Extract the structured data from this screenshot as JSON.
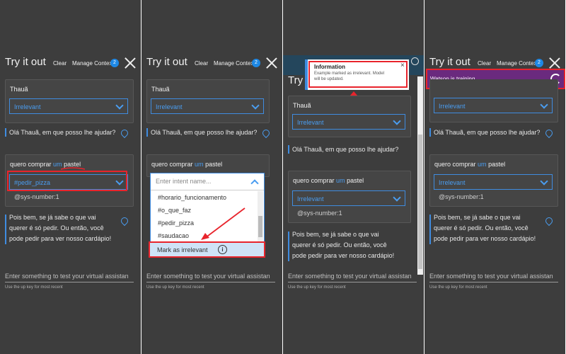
{
  "header": {
    "title": "Try it out",
    "clear": "Clear",
    "manage": "Manage Context",
    "badge": "2",
    "title_short": "Try"
  },
  "card1": {
    "name": "Thauã",
    "value": "Irrelevant"
  },
  "bot1": "Olá Thauã, em que posso lhe ajudar?",
  "user": {
    "before": "quero comprar ",
    "um": "um",
    "space": " ",
    "pastel": "pastel"
  },
  "intent_p1": "#pedir_pizza",
  "intent_irrelevant": "Irrelevant",
  "entity": "@sys-number:1",
  "bot2": {
    "l1": "Pois bem, se já sabe o que vai",
    "l2": "querer é só pedir. Ou então, você",
    "l3": "pode pedir para ver nosso cardápio!"
  },
  "input": {
    "placeholder": "Enter something to test your virtual assistan",
    "hint": "Use the up key for most recent"
  },
  "dropdown": {
    "placeholder": "Enter intent name...",
    "options": [
      "#horario_funcionamento",
      "#o_que_faz",
      "#pedir_pizza",
      "#saudacao"
    ],
    "mark": "Mark as irrelevant",
    "info_glyph": "i"
  },
  "notification": {
    "title": "Information",
    "l1": "Example marked as irrelevant. Model",
    "l2": "will be updated.",
    "close": "×"
  },
  "training": {
    "text": "Watson is training"
  },
  "colors": {
    "accent": "#3f8ce0",
    "annotation": "#e8242c",
    "training_bg": "#6a2a7e"
  }
}
